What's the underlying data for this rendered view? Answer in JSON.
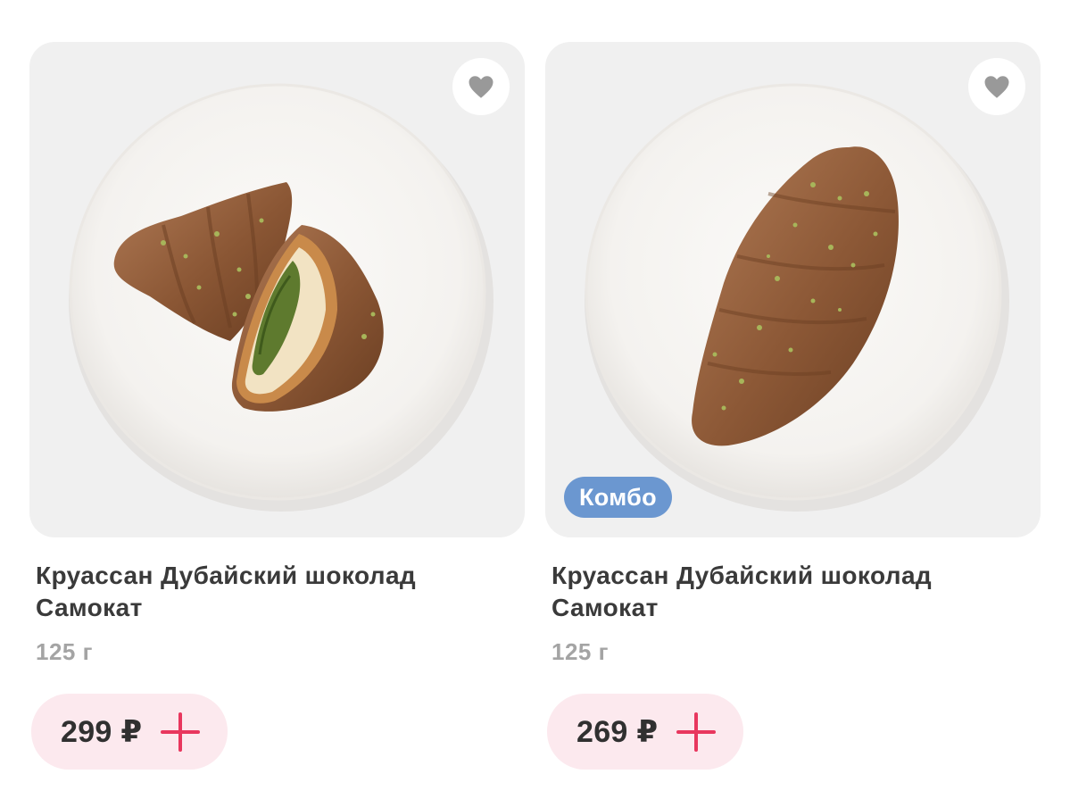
{
  "colors": {
    "card_background": "#f0f0f0",
    "badge_background": "#6b97d0",
    "price_pill_background": "#fce9ee",
    "plus_accent": "#e8375e",
    "title_text": "#3a3a3a",
    "weight_text": "#a4a4a4"
  },
  "products": [
    {
      "title": "Круассан Дубайский шоколад Самокат",
      "weight": "125 г",
      "price": "299 ₽",
      "badge": "",
      "favorite_icon": "heart-icon",
      "add_icon": "plus-icon"
    },
    {
      "title": "Круассан Дубайский шоколад Самокат",
      "weight": "125 г",
      "price": "269 ₽",
      "badge": "Комбо",
      "favorite_icon": "heart-icon",
      "add_icon": "plus-icon"
    }
  ]
}
